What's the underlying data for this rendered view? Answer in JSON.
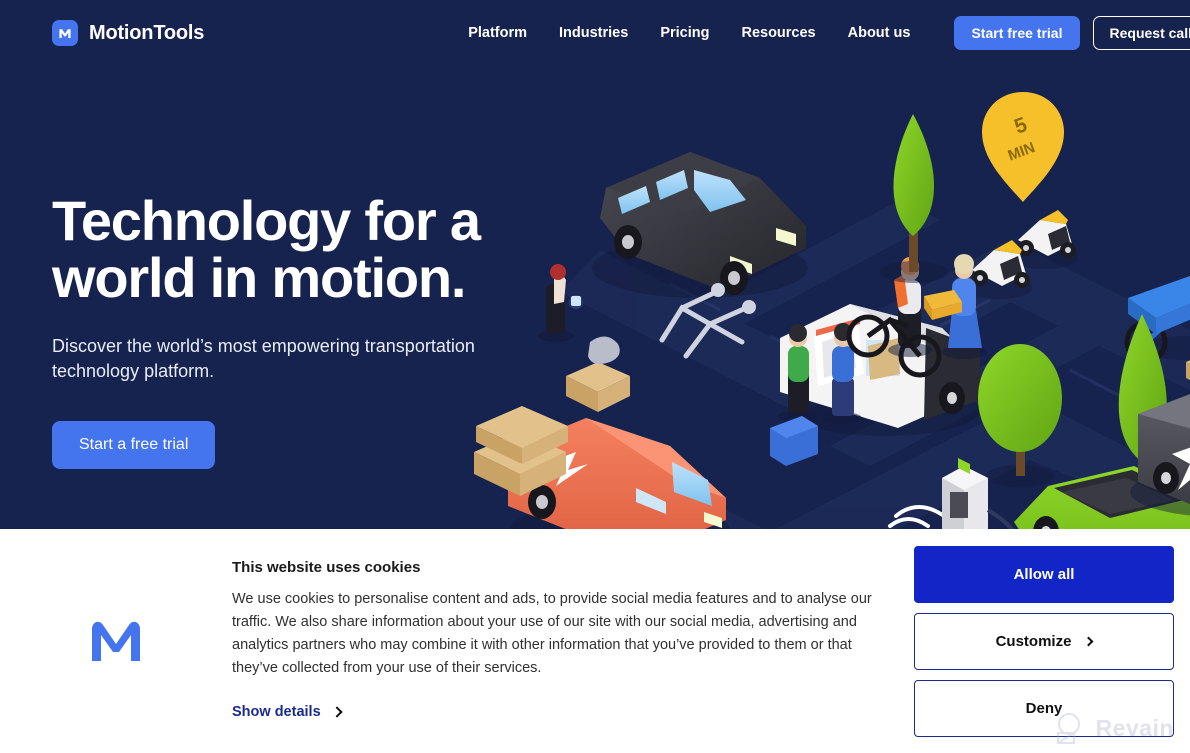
{
  "brand": {
    "name": "MotionTools",
    "logo_icon": "motiontools-m-logo",
    "logo_color": "#4574ef"
  },
  "colors": {
    "hero_background": "#16234f",
    "accent_blue": "#4574ef",
    "cookie_primary": "#1226c8",
    "cookie_link": "#1b2a8f",
    "surface_white": "#ffffff"
  },
  "nav": {
    "links": [
      {
        "label": "Platform"
      },
      {
        "label": "Industries"
      },
      {
        "label": "Pricing"
      },
      {
        "label": "Resources"
      },
      {
        "label": "About us"
      }
    ],
    "primary_cta": "Start free trial",
    "secondary_cta": "Request call"
  },
  "hero": {
    "title_line1": "Technology for a",
    "title_line2": "world in motion.",
    "subtitle": "Discover the world’s most empowering transportation technology platform.",
    "cta": "Start a free trial",
    "illustration": {
      "name": "isometric-city-transport-illustration",
      "badge_line1": "5",
      "badge_line2": "MIN"
    }
  },
  "cookie_banner": {
    "logo_icon": "motiontools-m-logo",
    "title": "This website uses cookies",
    "body": "We use cookies to personalise content and ads, to provide social media features and to analyse our traffic. We also share information about your use of our site with our social media, advertising and analytics partners who may combine it with other information that you’ve provided to them or that they’ve collected from your use of their services.",
    "details_label": "Show details",
    "buttons": {
      "allow": "Allow all",
      "customize": "Customize",
      "deny": "Deny"
    }
  },
  "watermark": {
    "text": "Revain",
    "icon": "revain-logo-icon"
  }
}
